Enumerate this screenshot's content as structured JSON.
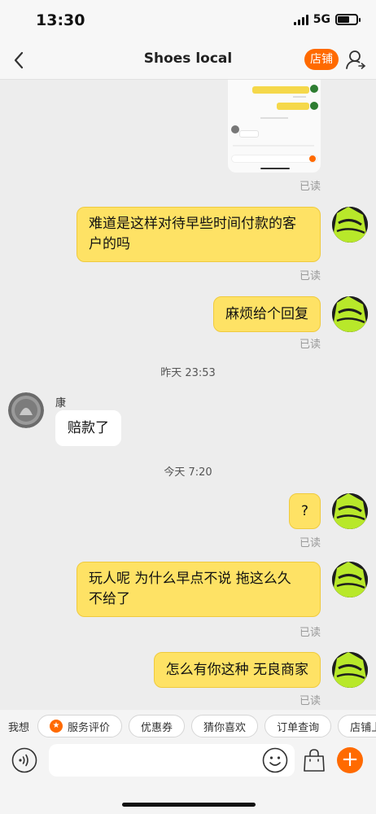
{
  "status_bar": {
    "time": "13:30",
    "network": "5G"
  },
  "nav": {
    "title": "Shoes local",
    "store_label": "店铺"
  },
  "read_label": "已读",
  "messages": [
    {
      "text": "难道是这样对待早些时间付款的客户的吗"
    },
    {
      "text": "麻烦给个回复"
    },
    {
      "timestamp": "昨天 23:53",
      "sender": "康",
      "text": "赔款了"
    },
    {
      "timestamp": "今天 7:20",
      "text": "?"
    },
    {
      "text": "玩人呢 为什么早点不说 拖这么久 不给了"
    },
    {
      "text": "怎么有你这种 无良商家"
    }
  ],
  "quick_bar": {
    "label": "我想",
    "chips": [
      "服务评价",
      "优惠券",
      "猜你喜欢",
      "订单查询",
      "店铺上新"
    ]
  },
  "input": {
    "placeholder": ""
  },
  "colors": {
    "accent": "#ff6a00",
    "my_bubble": "#fee265",
    "their_bubble": "#ffffff"
  },
  "icons": [
    "back-arrow-icon",
    "user-profile-icon",
    "voice-icon",
    "emoji-icon",
    "shopping-bag-icon",
    "plus-icon"
  ]
}
